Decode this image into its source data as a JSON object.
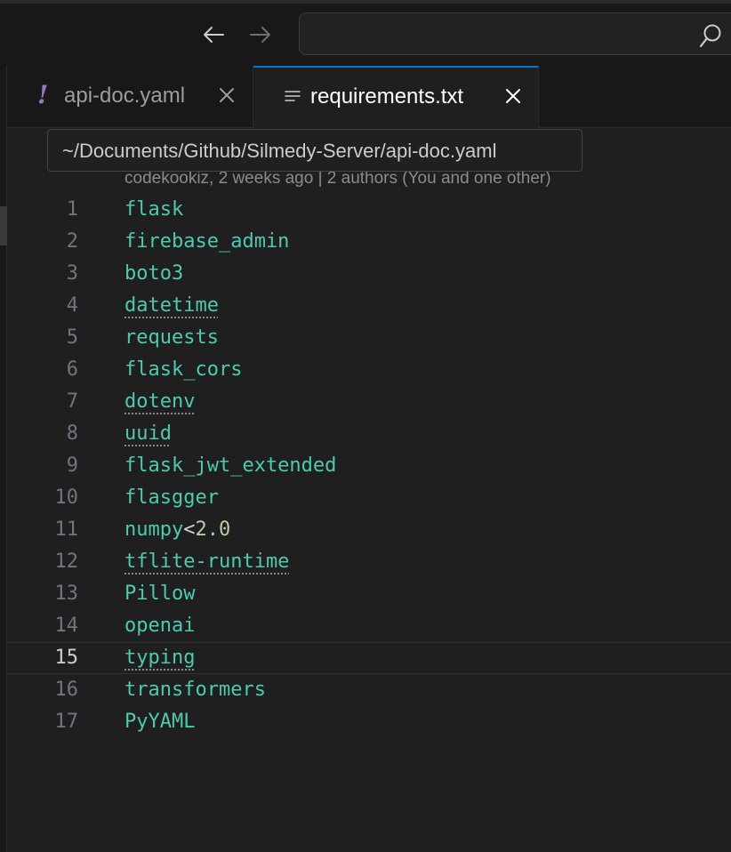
{
  "titlebar": {
    "back_icon": "arrow-left-icon",
    "forward_icon": "arrow-right-icon",
    "search_placeholder": "",
    "search_icon": "search-icon"
  },
  "tabs": [
    {
      "label": "api-doc.yaml",
      "icon": "yaml-file-icon",
      "active": false
    },
    {
      "label": "requirements.txt",
      "icon": "text-file-icon",
      "active": true
    }
  ],
  "tooltip": {
    "text": "~/Documents/Github/Silmedy-Server/api-doc.yaml"
  },
  "blame": {
    "text": "codekookiz, 2 weeks ago | 2 authors (You and one other)"
  },
  "editor": {
    "current_line": 15,
    "lines": [
      {
        "num": "1",
        "text": "flask"
      },
      {
        "num": "2",
        "text": "firebase_admin"
      },
      {
        "num": "3",
        "text": "boto3"
      },
      {
        "num": "4",
        "text": "datetime"
      },
      {
        "num": "5",
        "text": "requests"
      },
      {
        "num": "6",
        "text": "flask_cors"
      },
      {
        "num": "7",
        "text": "dotenv"
      },
      {
        "num": "8",
        "text": "uuid"
      },
      {
        "num": "9",
        "text": "flask_jwt_extended"
      },
      {
        "num": "10",
        "text": "flasgger"
      },
      {
        "num": "11",
        "text": "numpy",
        "op": "<",
        "version": "2.0"
      },
      {
        "num": "12",
        "text": "tflite-runtime"
      },
      {
        "num": "13",
        "text": "Pillow"
      },
      {
        "num": "14",
        "text": "openai"
      },
      {
        "num": "15",
        "text": "typing"
      },
      {
        "num": "16",
        "text": "transformers"
      },
      {
        "num": "17",
        "text": "PyYAML"
      }
    ]
  }
}
